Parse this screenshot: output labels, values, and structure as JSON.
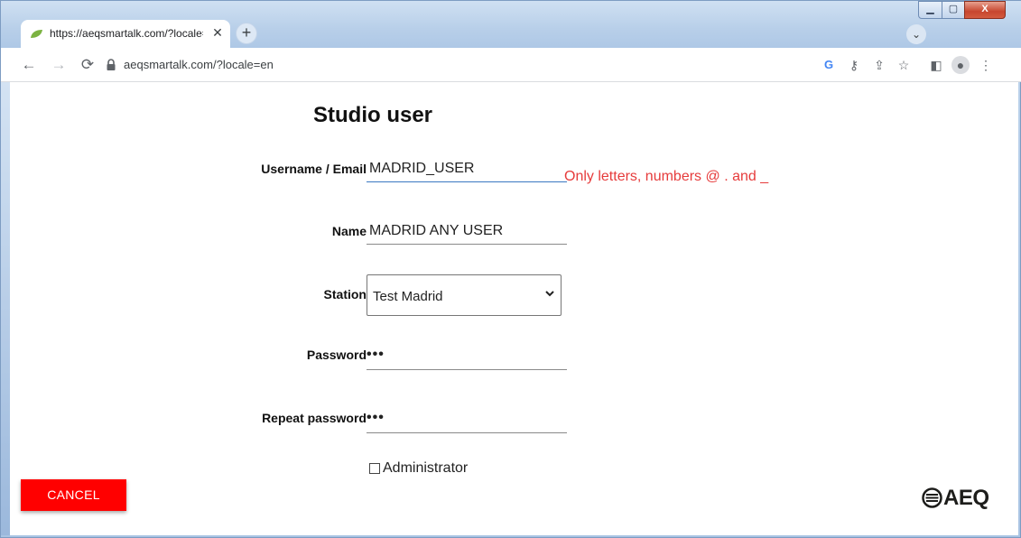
{
  "browser": {
    "tab_title": "https://aeqsmartalk.com/?locale=",
    "tab_close": "✕",
    "new_tab": "+",
    "tab_search": "⌄",
    "url": "aeqsmartalk.com/?locale=en",
    "window_buttons": {
      "minimize": "▁",
      "maximize": "▢",
      "close": "X"
    }
  },
  "page": {
    "title": "Studio user",
    "fields": {
      "username": {
        "label": "Username / Email",
        "value": "MADRID_USER",
        "error": "Only letters, numbers @ . and _"
      },
      "name": {
        "label": "Name",
        "value": "MADRID ANY USER"
      },
      "station": {
        "label": "Station",
        "value": "Test Madrid"
      },
      "password": {
        "label": "Password",
        "value": "•••"
      },
      "repeat_password": {
        "label": "Repeat password",
        "value": "•••"
      }
    },
    "administrator": {
      "label": "Administrator",
      "checked": false
    },
    "cancel_button": "CANCEL",
    "logo_text": "AEQ"
  },
  "colors": {
    "cancel_bg": "#ff0000",
    "error_text": "#e63b3b",
    "focus_underline": "#3b78c2"
  }
}
